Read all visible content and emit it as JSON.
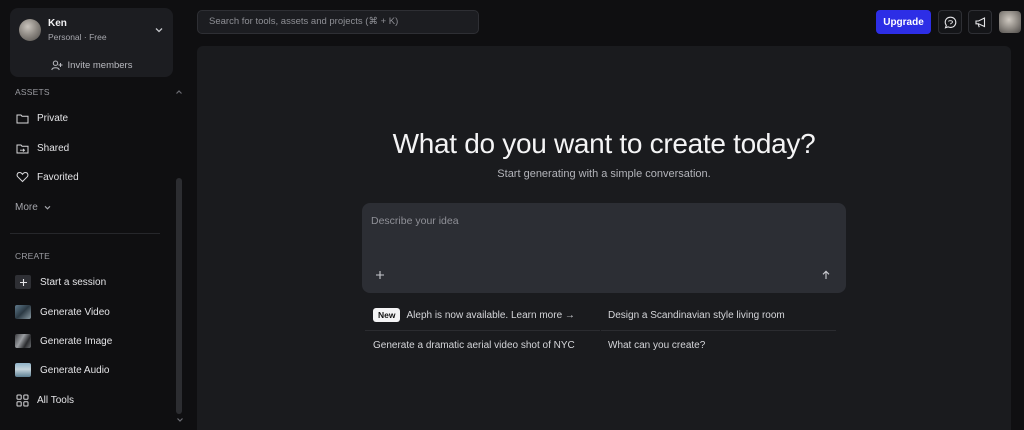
{
  "account": {
    "name": "Ken",
    "plan": "Personal · Free",
    "invite_label": "Invite members"
  },
  "sidebar": {
    "assets_label": "ASSETS",
    "assets": [
      {
        "label": "Private",
        "icon": "folder-icon"
      },
      {
        "label": "Shared",
        "icon": "shared-folder-icon"
      },
      {
        "label": "Favorited",
        "icon": "heart-icon"
      }
    ],
    "more_label": "More",
    "create_label": "CREATE",
    "create": [
      {
        "label": "Start a session",
        "icon": "plus-icon"
      },
      {
        "label": "Generate Video",
        "icon": "video-thumbnail"
      },
      {
        "label": "Generate Image",
        "icon": "image-thumbnail"
      },
      {
        "label": "Generate Audio",
        "icon": "audio-thumbnail"
      },
      {
        "label": "All Tools",
        "icon": "grid-icon"
      }
    ]
  },
  "topbar": {
    "search_placeholder": "Search for tools, assets and projects (⌘ + K)",
    "upgrade_label": "Upgrade",
    "accent": "#2d2ee6"
  },
  "main": {
    "headline": "What do you want to create today?",
    "subhead": "Start generating with a simple conversation.",
    "prompt_placeholder": "Describe your idea",
    "suggestions": {
      "badge": "New",
      "announcement": "Aleph is now available. Learn more →",
      "s1": "Design a Scandinavian style living room",
      "s2": "Generate a dramatic aerial video shot of NYC",
      "s3": "What can you create?"
    }
  }
}
